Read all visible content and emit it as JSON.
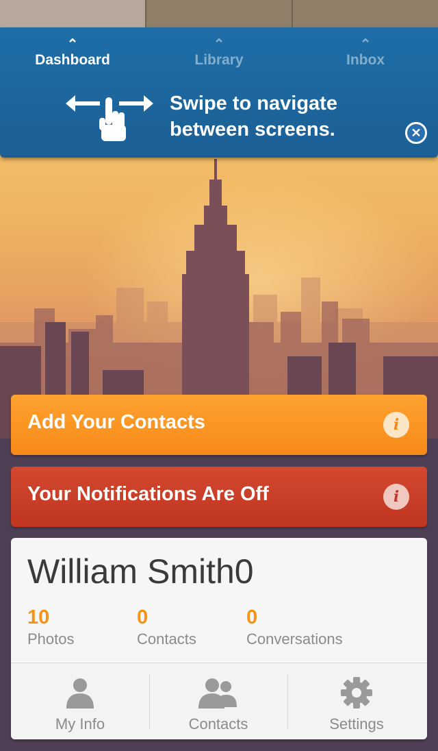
{
  "nav": {
    "tabs": [
      {
        "label": "Dashboard",
        "active": true
      },
      {
        "label": "Library",
        "active": false
      },
      {
        "label": "Inbox",
        "active": false
      }
    ],
    "hint_line1": "Swipe to navigate",
    "hint_line2": "between screens.",
    "close_icon": "close-icon"
  },
  "alerts": {
    "contacts": {
      "label": "Add Your Contacts",
      "color": "#f68a18",
      "icon": "info-icon"
    },
    "notifications": {
      "label": "Your Notifications Are Off",
      "color": "#c23a25",
      "icon": "info-icon"
    }
  },
  "profile": {
    "name": "William Smith0",
    "stats": [
      {
        "value": "10",
        "label": "Photos"
      },
      {
        "value": "0",
        "label": "Contacts"
      },
      {
        "value": "0",
        "label": "Conversations"
      }
    ],
    "accent": "#f39419",
    "actions": [
      {
        "label": "My Info",
        "icon": "person-icon"
      },
      {
        "label": "Contacts",
        "icon": "people-icon"
      },
      {
        "label": "Settings",
        "icon": "gear-icon"
      }
    ]
  }
}
